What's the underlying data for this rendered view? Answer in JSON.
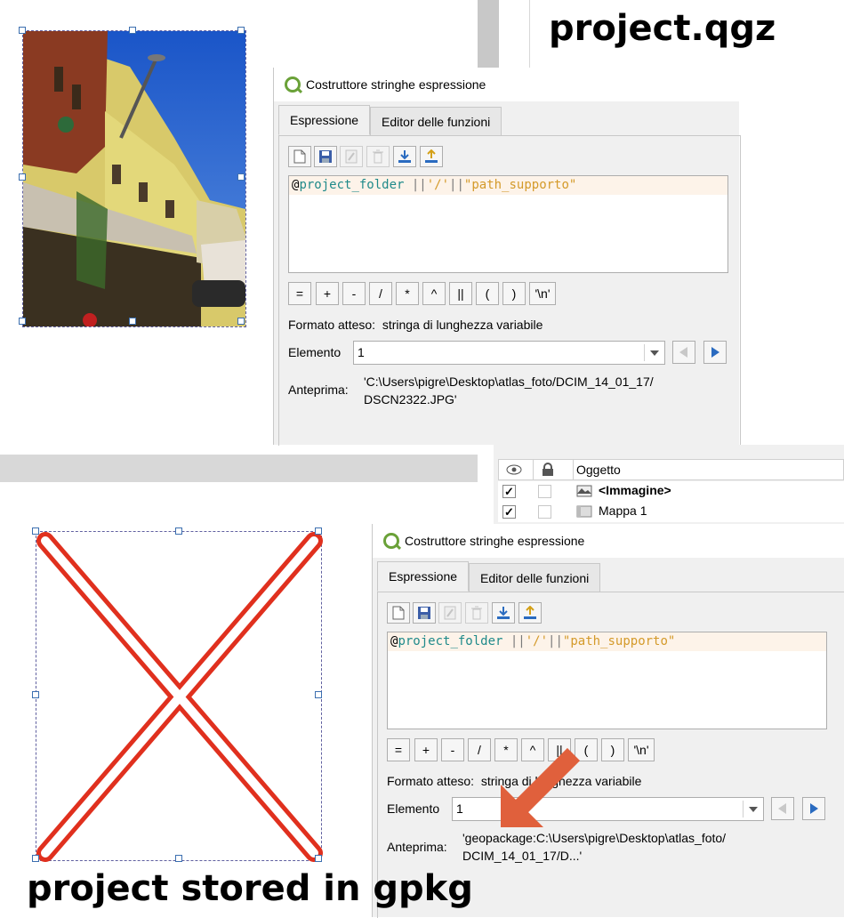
{
  "top_caption": "project.qgz",
  "bottom_caption": "project stored in gpkg",
  "colors": {
    "accent_arrow": "#e0603c",
    "red_x": "#e0301e",
    "qgis_green": "#6aa138"
  },
  "dialog_top": {
    "title": "Costruttore stringhe espressione",
    "tabs": [
      "Espressione",
      "Editor delle funzioni"
    ],
    "toolbar_icons": [
      "new-file-icon",
      "save-icon",
      "edit-icon",
      "delete-icon",
      "import-icon",
      "export-icon"
    ],
    "expression": {
      "at": "@",
      "var": "project_folder",
      "op1": " ||",
      "str1": "'/'",
      "op2": "||",
      "str2": "\"path_supporto\""
    },
    "operators": [
      "=",
      "+",
      "-",
      "/",
      "*",
      "^",
      "||",
      "(",
      ")",
      "'\\n'"
    ],
    "expected_format_label": "Formato atteso:",
    "expected_format_value": "stringa di lunghezza variabile",
    "element_label": "Elemento",
    "element_value": "1",
    "preview_label": "Anteprima:",
    "preview_line1": "'C:\\Users\\pigre\\Desktop\\atlas_foto/DCIM_14_01_17/",
    "preview_line2": "DSCN2322.JPG'"
  },
  "dialog_bottom": {
    "title": "Costruttore stringhe espressione",
    "tabs": [
      "Espressione",
      "Editor delle funzioni"
    ],
    "toolbar_icons": [
      "new-file-icon",
      "save-icon",
      "edit-icon",
      "delete-icon",
      "import-icon",
      "export-icon"
    ],
    "expression": {
      "at": "@",
      "var": "project_folder",
      "op1": " ||",
      "str1": "'/'",
      "op2": "||",
      "str2": "\"path_supporto\""
    },
    "operators": [
      "=",
      "+",
      "-",
      "/",
      "*",
      "^",
      "||",
      "(",
      ")",
      "'\\n'"
    ],
    "expected_format_label": "Formato atteso:",
    "expected_format_value": "stringa di lunghezza variabile",
    "element_label": "Elemento",
    "element_value": "1",
    "preview_label": "Anteprima:",
    "preview_line1": "'geopackage:C:\\Users\\pigre\\Desktop\\atlas_foto/",
    "preview_line2": "DCIM_14_01_17/D...'"
  },
  "layers_panel": {
    "column_header": "Oggetto",
    "rows": [
      {
        "label": "<Immagine>",
        "checked": true,
        "bold": true,
        "icon": "image-item-icon"
      },
      {
        "label": "Mappa 1",
        "checked": true,
        "bold": false,
        "icon": "map-item-icon"
      }
    ]
  }
}
